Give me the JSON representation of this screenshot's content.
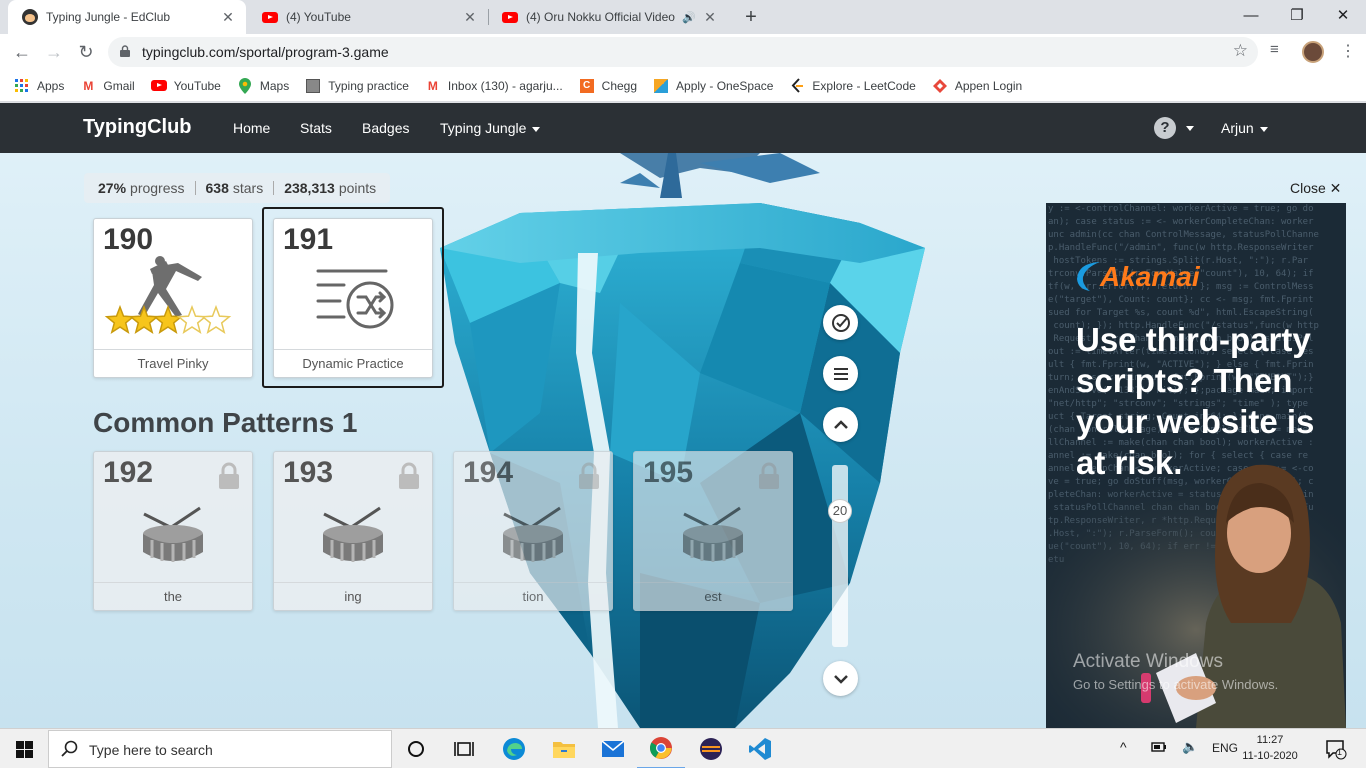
{
  "browser": {
    "tabs": [
      {
        "title": "Typing Jungle - EdClub",
        "active": true
      },
      {
        "title": "(4) YouTube",
        "active": false
      },
      {
        "title": "(4) Oru Nokku Official Video",
        "active": false
      }
    ],
    "new_tab": "+",
    "window_controls": {
      "minimize": "—",
      "maximize": "❐",
      "close": "✕"
    },
    "url": "typingclub.com/sportal/program-3.game",
    "bookmarks": [
      {
        "label": "Apps",
        "icon": "apps-grid-icon"
      },
      {
        "label": "Gmail",
        "icon": "gmail-icon"
      },
      {
        "label": "YouTube",
        "icon": "youtube-icon"
      },
      {
        "label": "Maps",
        "icon": "maps-icon"
      },
      {
        "label": "Typing practice",
        "icon": "typing-practice-icon"
      },
      {
        "label": "Inbox (130) - agarju...",
        "icon": "gmail-icon"
      },
      {
        "label": "Chegg",
        "icon": "chegg-icon"
      },
      {
        "label": "Apply - OneSpace",
        "icon": "onespace-icon"
      },
      {
        "label": "Explore - LeetCode",
        "icon": "leetcode-icon"
      },
      {
        "label": "Appen Login",
        "icon": "appen-icon"
      }
    ]
  },
  "site": {
    "brand": "TypingClub",
    "nav": [
      "Home",
      "Stats",
      "Badges",
      "Typing Jungle"
    ],
    "help": "?",
    "user": "Arjun"
  },
  "progress": {
    "percent": "27%",
    "percent_label": "progress",
    "stars": "638",
    "stars_label": "stars",
    "points": "238,313",
    "points_label": "points"
  },
  "lessons": [
    {
      "number": "190",
      "title": "Travel Pinky",
      "stars_earned": 3,
      "stars_total": 5,
      "locked": false
    },
    {
      "number": "191",
      "title": "Dynamic Practice",
      "locked": false,
      "selected": true
    }
  ],
  "section": {
    "title": "Common Patterns 1",
    "lessons": [
      {
        "number": "192",
        "title": "the",
        "locked": true
      },
      {
        "number": "193",
        "title": "ing",
        "locked": true
      },
      {
        "number": "194",
        "title": "tion",
        "locked": true
      },
      {
        "number": "195",
        "title": "est",
        "locked": true
      }
    ]
  },
  "side_controls": {
    "scroll_level": "20"
  },
  "ad": {
    "close_label": "Close",
    "brand": "Akamai",
    "headline": "Use third-party scripts? Then your website is at risk."
  },
  "watermark": {
    "line1": "Activate Windows",
    "line2": "Go to Settings to activate Windows."
  },
  "taskbar": {
    "search_placeholder": "Type here to search",
    "language": "ENG",
    "time": "11:27",
    "date": "11-10-2020",
    "notification_count": "1"
  },
  "colors": {
    "header_bg": "#2b3035",
    "sky": "#dff0f8",
    "star": "#f7c51b",
    "akamai_orange": "#ff7a1a"
  }
}
